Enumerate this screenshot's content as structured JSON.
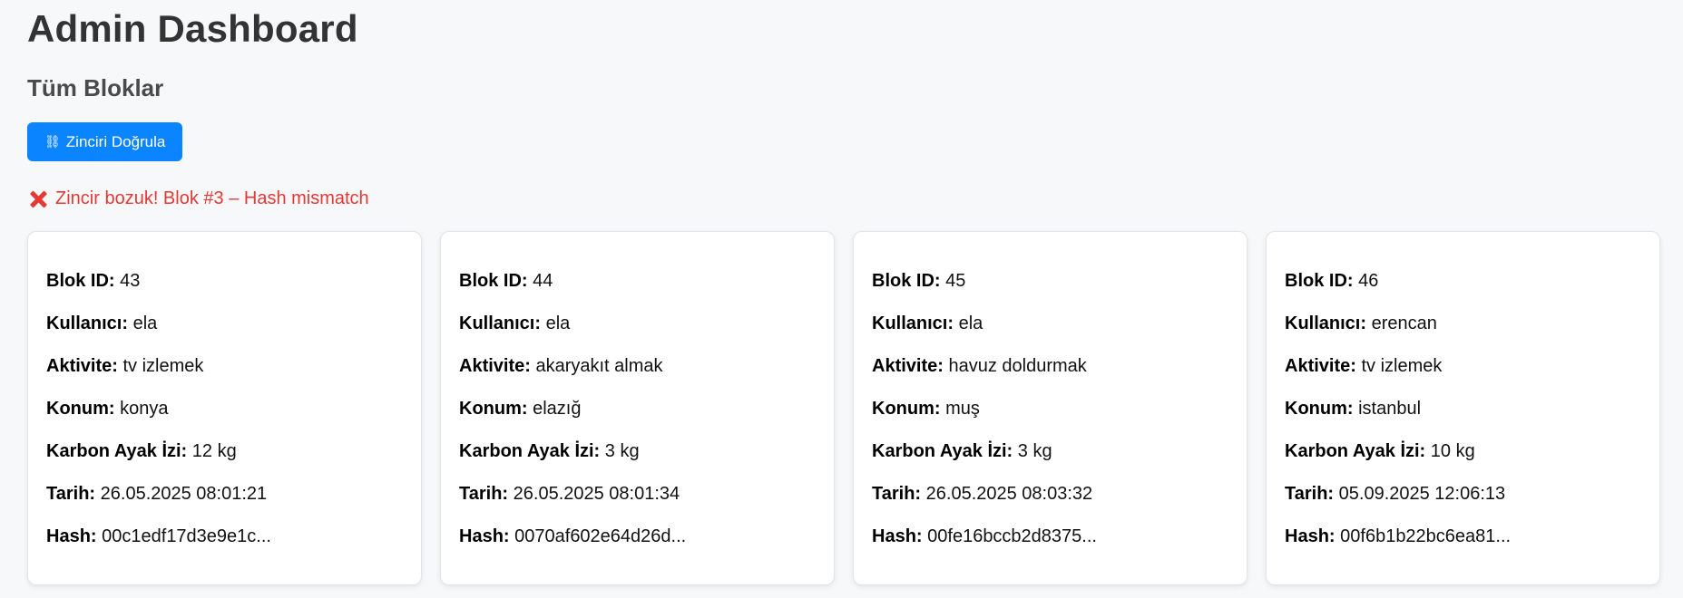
{
  "header": {
    "title": "Admin Dashboard",
    "section_title": "Tüm Bloklar"
  },
  "actions": {
    "verify_label": "Zinciri Doğrula",
    "verify_icon": "chain-icon"
  },
  "status": {
    "message": "Zincir bozuk! Blok #3 – Hash mismatch",
    "icon": "cross-mark-icon",
    "color": "#e53935"
  },
  "colors": {
    "accent": "#0a84ff",
    "background": "#f7f8fa",
    "card": "#ffffff"
  },
  "labels": {
    "block_id": "Blok ID:",
    "user": "Kullanıcı:",
    "activity": "Aktivite:",
    "location": "Konum:",
    "carbon": "Karbon Ayak İzi:",
    "date": "Tarih:",
    "hash": "Hash:"
  },
  "blocks": [
    {
      "block_id": "43",
      "user": "ela",
      "activity": "tv izlemek",
      "location": "konya",
      "carbon": "12 kg",
      "date": "26.05.2025 08:01:21",
      "hash": "00c1edf17d3e9e1c..."
    },
    {
      "block_id": "44",
      "user": "ela",
      "activity": "akaryakıt almak",
      "location": "elazığ",
      "carbon": "3 kg",
      "date": "26.05.2025 08:01:34",
      "hash": "0070af602e64d26d..."
    },
    {
      "block_id": "45",
      "user": "ela",
      "activity": "havuz doldurmak",
      "location": "muş",
      "carbon": "3 kg",
      "date": "26.05.2025 08:03:32",
      "hash": "00fe16bccb2d8375..."
    },
    {
      "block_id": "46",
      "user": "erencan",
      "activity": "tv izlemek",
      "location": "istanbul",
      "carbon": "10 kg",
      "date": "05.09.2025 12:06:13",
      "hash": "00f6b1b22bc6ea81..."
    }
  ]
}
